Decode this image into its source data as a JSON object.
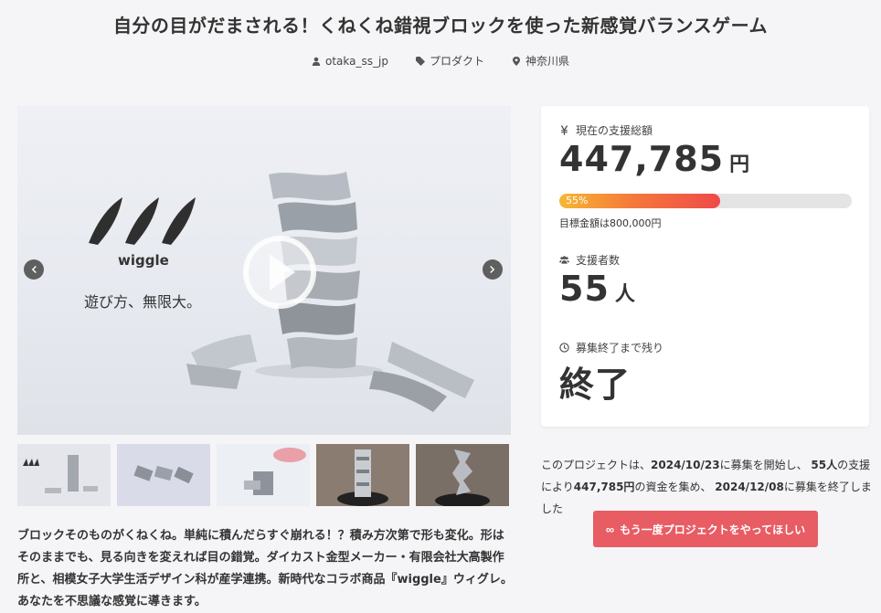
{
  "project": {
    "title": "自分の目がだまされる！くねくね錯視ブロックを使った新感覚バランスゲーム",
    "meta": {
      "user": "otaka_ss_jp",
      "category": "プロダクト",
      "location": "神奈川県"
    }
  },
  "hero": {
    "brand": "wiggle",
    "tagline": "遊び方、無限大。",
    "thumbnails": [
      "thumb-1",
      "thumb-2",
      "thumb-3",
      "thumb-4",
      "thumb-5"
    ]
  },
  "funding": {
    "total_label": "現在の支援総額",
    "total_value": "447,785",
    "total_unit": "円",
    "progress_percent": 55,
    "progress_label": "55%",
    "goal_text": "目標金額は800,000円",
    "backers_label": "支援者数",
    "backers_value": "55",
    "backers_unit": "人",
    "remaining_label": "募集終了まで残り",
    "remaining_value": "終了"
  },
  "summary": {
    "p1": "このプロジェクトは、",
    "start_date": "2024/10/23",
    "p2": "に募集を開始し、",
    "backers": "55人",
    "p3": "の支援により",
    "amount": "447,785円",
    "p4": "の資金を集め、",
    "end_date": "2024/12/08",
    "p5": "に募集を終了しました"
  },
  "cta": {
    "label": "もう一度プロジェクトをやってほしい",
    "icon": "infinity-icon"
  },
  "description": "ブロックそのものがくねくね。単純に積んだらすぐ崩れる！？積み方次第で形も変化。形はそのままでも、見る向きを変えれば目の錯覚。ダイカスト金型メーカー・有限会社大高製作所と、相模女子大学生活デザイン科が産学連携。新時代なコラボ商品『wiggle』ウィグレ。あなたを不思議な感覚に導きます。",
  "colors": {
    "accent": "#e85c64",
    "progress_start": "#f7b733",
    "progress_end": "#ef4a4a",
    "background": "#f5f5f7"
  }
}
